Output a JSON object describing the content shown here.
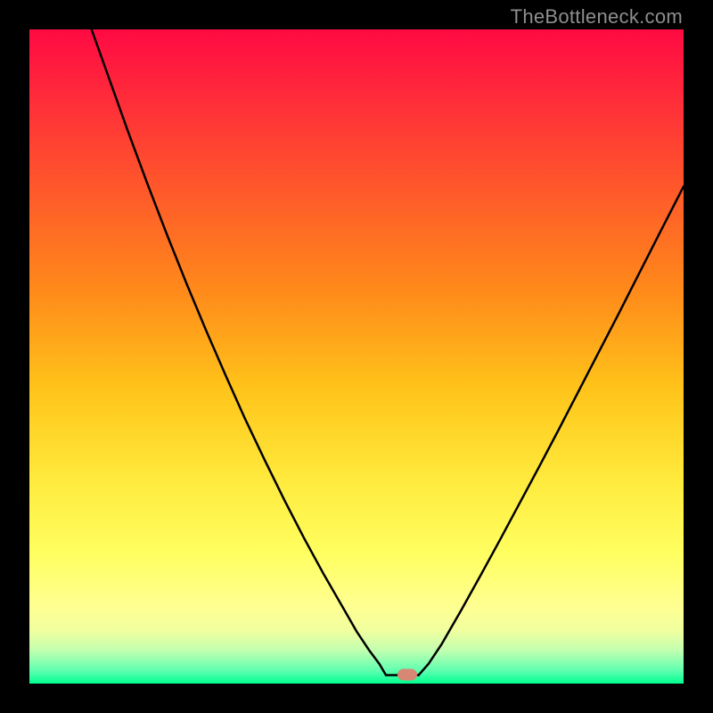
{
  "attribution": "TheBottleneck.com",
  "colors": {
    "curve": "#000000",
    "marker": "#d88775",
    "frame": "#000000"
  },
  "chart_data": {
    "type": "line",
    "title": "",
    "xlabel": "",
    "ylabel": "",
    "xlim": [
      0,
      100
    ],
    "ylim": [
      0,
      100
    ],
    "left_branch": {
      "comment": "descending left curve, (x, y) with origin at lower-left, units = percent of plot area",
      "points": [
        [
          9.5,
          100.0
        ],
        [
          12.0,
          93.0
        ],
        [
          15.0,
          84.6
        ],
        [
          18.0,
          76.5
        ],
        [
          21.0,
          68.7
        ],
        [
          24.0,
          61.2
        ],
        [
          27.0,
          54.0
        ],
        [
          30.0,
          47.1
        ],
        [
          33.0,
          40.4
        ],
        [
          36.0,
          34.1
        ],
        [
          39.0,
          28.0
        ],
        [
          42.0,
          22.2
        ],
        [
          45.0,
          16.7
        ],
        [
          48.0,
          11.5
        ],
        [
          50.0,
          8.0
        ],
        [
          52.0,
          5.0
        ],
        [
          53.5,
          3.0
        ],
        [
          54.5,
          1.3
        ]
      ]
    },
    "floor": {
      "points": [
        [
          54.5,
          1.3
        ],
        [
          59.5,
          1.3
        ]
      ]
    },
    "right_branch": {
      "points": [
        [
          59.5,
          1.3
        ],
        [
          61.0,
          3.0
        ],
        [
          63.0,
          6.0
        ],
        [
          66.0,
          11.2
        ],
        [
          69.0,
          16.6
        ],
        [
          72.0,
          22.1
        ],
        [
          75.0,
          27.7
        ],
        [
          78.0,
          33.3
        ],
        [
          81.0,
          39.0
        ],
        [
          84.0,
          44.8
        ],
        [
          87.0,
          50.6
        ],
        [
          90.0,
          56.4
        ],
        [
          93.0,
          62.3
        ],
        [
          96.0,
          68.2
        ],
        [
          100.0,
          76.0
        ]
      ]
    },
    "minimum_marker": {
      "x": 57.7,
      "y": 1.3
    }
  }
}
